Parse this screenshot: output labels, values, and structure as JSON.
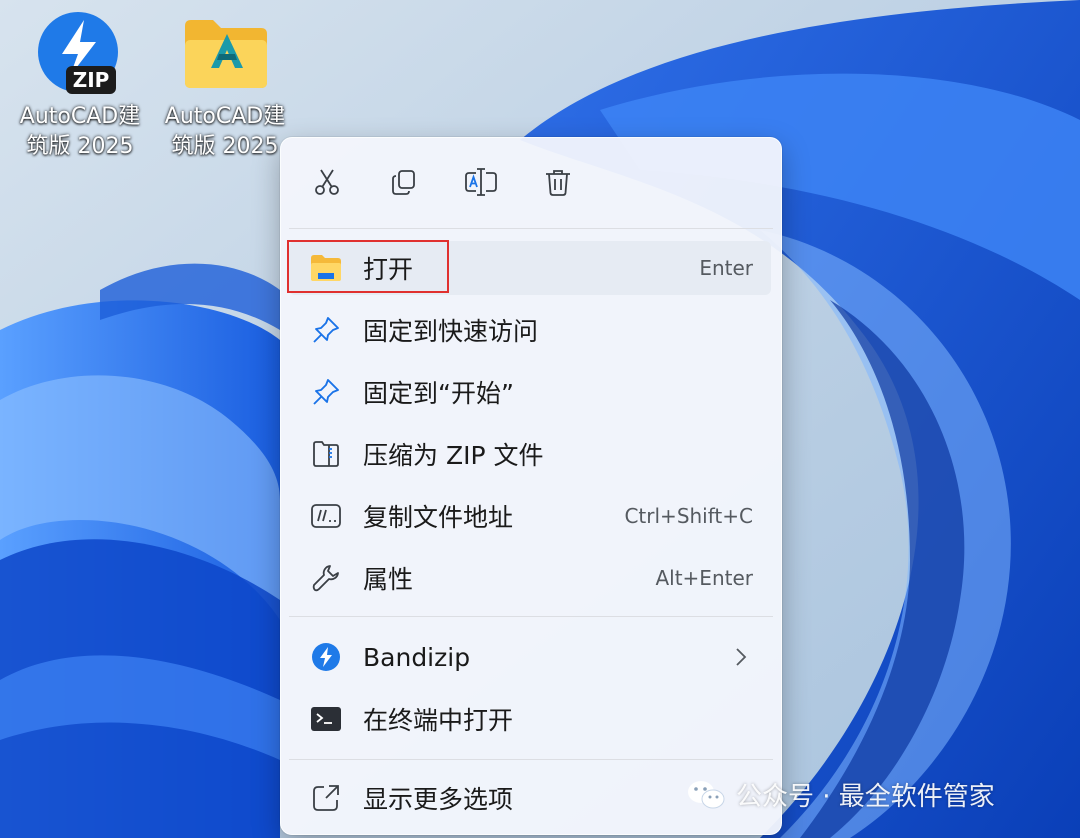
{
  "desktop": {
    "icons": [
      {
        "label": "AutoCAD建\n筑版 2025",
        "icon": "bandizip-zip-icon",
        "badge": "ZIP"
      },
      {
        "label": "AutoCAD建\n筑版 2025",
        "icon": "folder-autocad-icon"
      }
    ]
  },
  "context_menu": {
    "toolbar": [
      "cut-icon",
      "copy-icon",
      "rename-icon",
      "delete-icon"
    ],
    "items": [
      {
        "label": "打开",
        "shortcut": "Enter",
        "icon": "folder-icon"
      },
      {
        "label": "固定到快速访问",
        "shortcut": "",
        "icon": "pin-icon"
      },
      {
        "label": "固定到“开始”",
        "shortcut": "",
        "icon": "pin-icon"
      },
      {
        "label": "压缩为 ZIP 文件",
        "shortcut": "",
        "icon": "zip-folder-icon"
      },
      {
        "label": "复制文件地址",
        "shortcut": "Ctrl+Shift+C",
        "icon": "copy-path-icon"
      },
      {
        "label": "属性",
        "shortcut": "Alt+Enter",
        "icon": "wrench-icon"
      },
      {
        "label": "Bandizip",
        "shortcut": "",
        "icon": "bandizip-icon"
      },
      {
        "label": "在终端中打开",
        "shortcut": "",
        "icon": "terminal-icon"
      },
      {
        "label": "显示更多选项",
        "shortcut": "",
        "icon": "show-more-icon"
      }
    ]
  },
  "watermark": {
    "text": "公众号 · 最全软件管家"
  },
  "colors": {
    "accent": "#1a73e8",
    "highlight_box": "#e0302f"
  }
}
